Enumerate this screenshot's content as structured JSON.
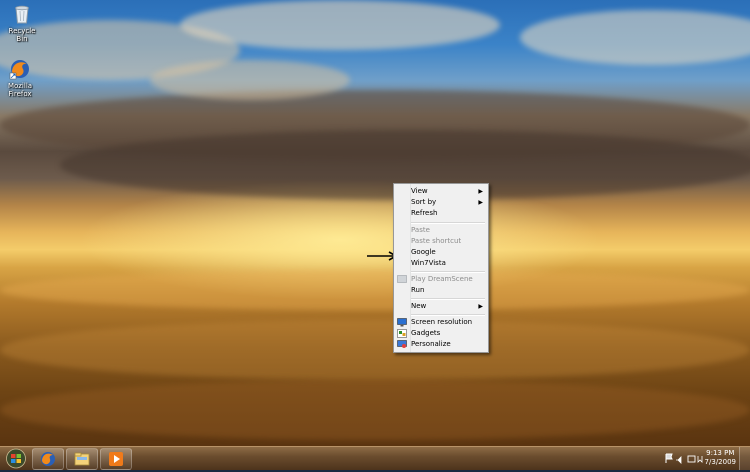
{
  "desktop_icons": [
    {
      "label": "Recycle Bin"
    },
    {
      "label": "Mozilla Firefox"
    }
  ],
  "context_menu": {
    "items": [
      {
        "label": "View",
        "submenu": true,
        "disabled": false
      },
      {
        "label": "Sort by",
        "submenu": true,
        "disabled": false
      },
      {
        "label": "Refresh",
        "submenu": false,
        "disabled": false
      },
      {
        "label": "Paste",
        "submenu": false,
        "disabled": true
      },
      {
        "label": "Paste shortcut",
        "submenu": false,
        "disabled": true
      },
      {
        "label": "Google",
        "submenu": false,
        "disabled": false
      },
      {
        "label": "Win7Vista",
        "submenu": false,
        "disabled": false
      },
      {
        "label": "Play DreamScene",
        "submenu": false,
        "disabled": true
      },
      {
        "label": "Run",
        "submenu": false,
        "disabled": false
      },
      {
        "label": "New",
        "submenu": true,
        "disabled": false
      },
      {
        "label": "Screen resolution",
        "submenu": false,
        "disabled": false,
        "icon": "display-icon"
      },
      {
        "label": "Gadgets",
        "submenu": false,
        "disabled": false,
        "icon": "gadgets-icon"
      },
      {
        "label": "Personalize",
        "submenu": false,
        "disabled": false,
        "icon": "personalize-icon"
      }
    ]
  },
  "taskbar": {
    "pinned": [
      "firefox-icon",
      "explorer-icon",
      "media-player-icon"
    ],
    "clock": {
      "time": "9:13 PM",
      "date": "7/3/2009"
    }
  }
}
